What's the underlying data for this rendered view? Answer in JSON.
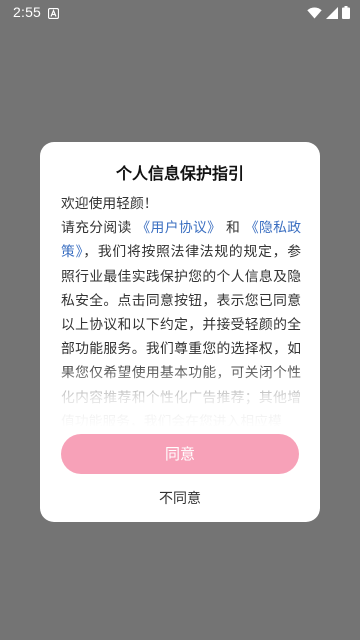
{
  "status_bar": {
    "time": "2:55",
    "notification_icon": "letter-a-notification-icon",
    "icons": [
      "wifi-icon",
      "cellular-signal-icon",
      "battery-icon"
    ]
  },
  "dialog": {
    "title": "个人信息保护指引",
    "greeting": "欢迎使用轻颜！",
    "intro": "请充分阅读",
    "user_agreement_link": "《用户协议》",
    "conjunction": "和",
    "privacy_policy_link": "《隐私政策》",
    "body": "，我们将按照法律法规的规定，参照行业最佳实践保护您的个人信息及隐私安全。点击同意按钮，表示您已同意以上协议和以下约定，并接受轻颜的全部功能服务。我们尊重您的选择权，如果您仅希望使用基本功能，可关闭个性化内容推荐和个性化广告推荐；其他增值功能服务，我们会在您进入相应模",
    "agree_label": "同意",
    "disagree_label": "不同意"
  },
  "colors": {
    "backdrop": "#747474",
    "link": "#3b6fc1",
    "agree_button": "#f7a1b8"
  }
}
